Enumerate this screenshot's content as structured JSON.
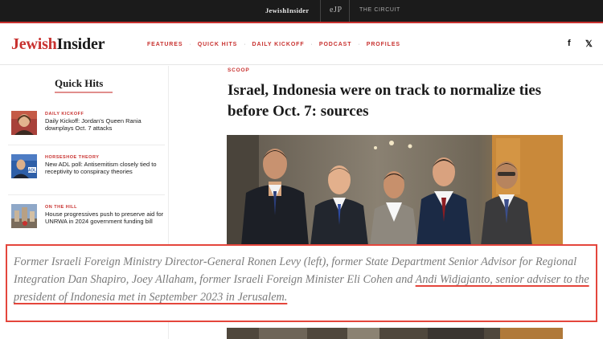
{
  "topbar": {
    "brand": "JewishInsider",
    "ep_logo": "eJP",
    "circuit": "THE CIRCUIT"
  },
  "header": {
    "logo_part1": "Jewish",
    "logo_part2": "Insider",
    "nav": [
      "FEATURES",
      "QUICK HITS",
      "DAILY KICKOFF",
      "PODCAST",
      "PROFILES"
    ],
    "social_icons": [
      "facebook-icon",
      "twitter-icon"
    ],
    "facebook_glyph": "f",
    "twitter_glyph": "𝕏"
  },
  "sidebar": {
    "title": "Quick Hits",
    "items": [
      {
        "kicker": "DAILY KICKOFF",
        "headline": "Daily Kickoff: Jordan's Queen Rania downplays Oct. 7 attacks"
      },
      {
        "kicker": "HORSESHOE THEORY",
        "headline": "New ADL poll: Antisemitism closely tied to receptivity to conspiracy theories"
      },
      {
        "kicker": "ON THE HILL",
        "headline": "House progressives push to preserve aid for UNRWA in 2024 government funding bill"
      }
    ]
  },
  "article": {
    "kicker": "SCOOP",
    "headline": "Israel, Indonesia were on track to normalize ties before Oct. 7: sources",
    "caption_plain": "Former Israeli Foreign Ministry Director-General Ronen Levy (left), former State Department Senior Advisor for Regional Integration Dan Shapiro, Joey Allaham, former Israeli Foreign Minister Eli Cohen and ",
    "caption_underlined": "Andi Widjajanto, senior adviser to the president of Indonesia met in September 2023 in Jerusalem."
  },
  "colors": {
    "accent": "#c8312f",
    "caption_border": "#e4463c",
    "topbar_bg": "#1b1b1b"
  }
}
